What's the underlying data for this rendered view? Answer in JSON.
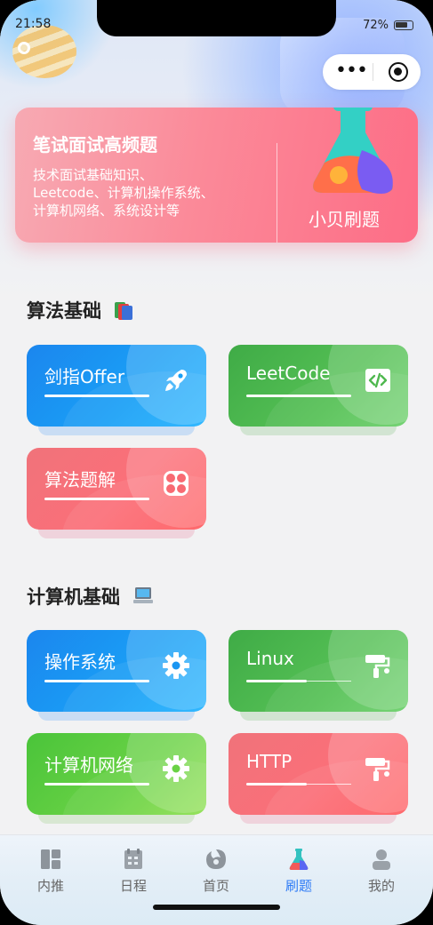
{
  "status_bar": {
    "time": "21:58",
    "battery": "72%"
  },
  "banner": {
    "title": "笔试面试高频题",
    "desc_line1": "技术面试基础知识、",
    "desc_line2": "Leetcode、计算机操作系统、",
    "desc_line3": "计算机网络、系统设计等",
    "brand": "小贝刷题"
  },
  "sections": {
    "algo": {
      "title": "算法基础",
      "emoji": "📚",
      "cards": [
        {
          "label": "剑指Offer",
          "icon": "rocket-icon"
        },
        {
          "label": "LeetCode",
          "icon": "code-icon"
        },
        {
          "label": "算法题解",
          "icon": "grid-icon"
        }
      ]
    },
    "cs": {
      "title": "计算机基础",
      "emoji": "💻",
      "cards": [
        {
          "label": "操作系统",
          "icon": "gear-icon"
        },
        {
          "label": "Linux",
          "icon": "paint-roller-icon"
        },
        {
          "label": "计算机网络",
          "icon": "gear-icon"
        },
        {
          "label": "HTTP",
          "icon": "paint-roller-icon"
        }
      ]
    }
  },
  "tabbar": {
    "items": [
      {
        "label": "内推",
        "icon": "dashboard-icon"
      },
      {
        "label": "日程",
        "icon": "calendar-icon"
      },
      {
        "label": "首页",
        "icon": "home-icon"
      },
      {
        "label": "刷题",
        "icon": "flask-icon",
        "active": true
      },
      {
        "label": "我的",
        "icon": "user-icon"
      }
    ]
  },
  "colors": {
    "accent": "#2f7cf6",
    "blue_card": "#1a8ff0",
    "green_card": "#4fb84f",
    "red_card": "#f86a72",
    "lime_card": "#5fcb40"
  }
}
